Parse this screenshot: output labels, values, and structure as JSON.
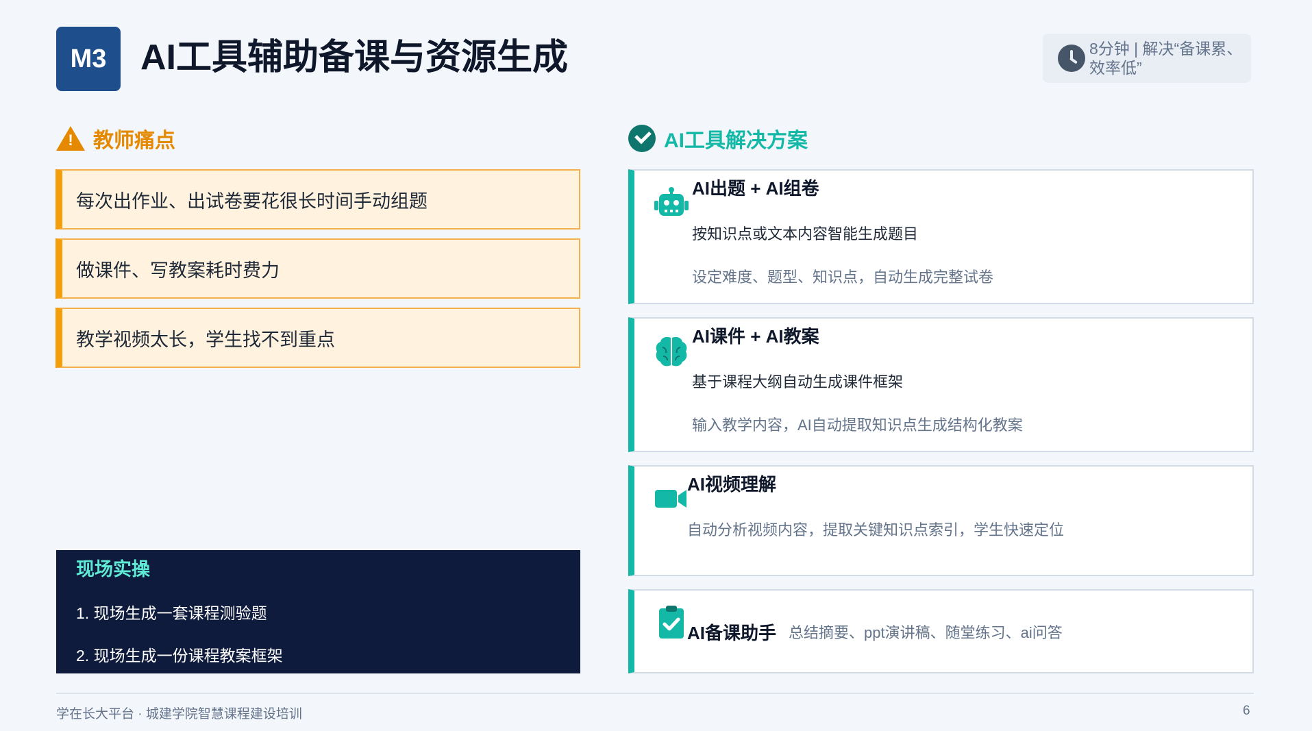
{
  "header": {
    "badge": "M3",
    "title": "AI工具辅助备课与资源生成",
    "duration_text": "8分钟 | 解决“备课累、效率低”"
  },
  "pain": {
    "heading": "教师痛点",
    "items": [
      "每次出作业、出试卷要花很长时间手动组题",
      "做课件、写教案耗时费力",
      "教学视频太长，学生找不到重点"
    ]
  },
  "practice": {
    "heading": "现场实操",
    "items": [
      "1. 现场生成一套课程测验题",
      "2. 现场生成一份课程教案框架"
    ]
  },
  "solution": {
    "heading": "AI工具解决方案",
    "cards": [
      {
        "title": "AI出题 + AI组卷",
        "line1": "按知识点或文本内容智能生成题目",
        "line2": "设定难度、题型、知识点，自动生成完整试卷",
        "icon": "robot-icon"
      },
      {
        "title": "AI课件 + AI教案",
        "line1": "基于课程大纲自动生成课件框架",
        "line2": "输入教学内容，AI自动提取知识点生成结构化教案",
        "icon": "brain-icon"
      },
      {
        "title": "AI视频理解",
        "line1": "自动分析视频内容，提取关键知识点索引，学生快速定位",
        "icon": "video-camera-icon"
      },
      {
        "title": "AI备课助手",
        "line1": "总结摘要、ppt演讲稿、随堂练习、ai问答",
        "icon": "clipboard-check-icon"
      }
    ]
  },
  "footer": {
    "left": "学在长大平台 · 城建学院智慧课程建设培训",
    "page": "6"
  },
  "colors": {
    "brand": "#1f4e8c",
    "warning": "#f59e0b",
    "teal": "#14b8a6",
    "dark_panel": "#0f1b3d"
  }
}
